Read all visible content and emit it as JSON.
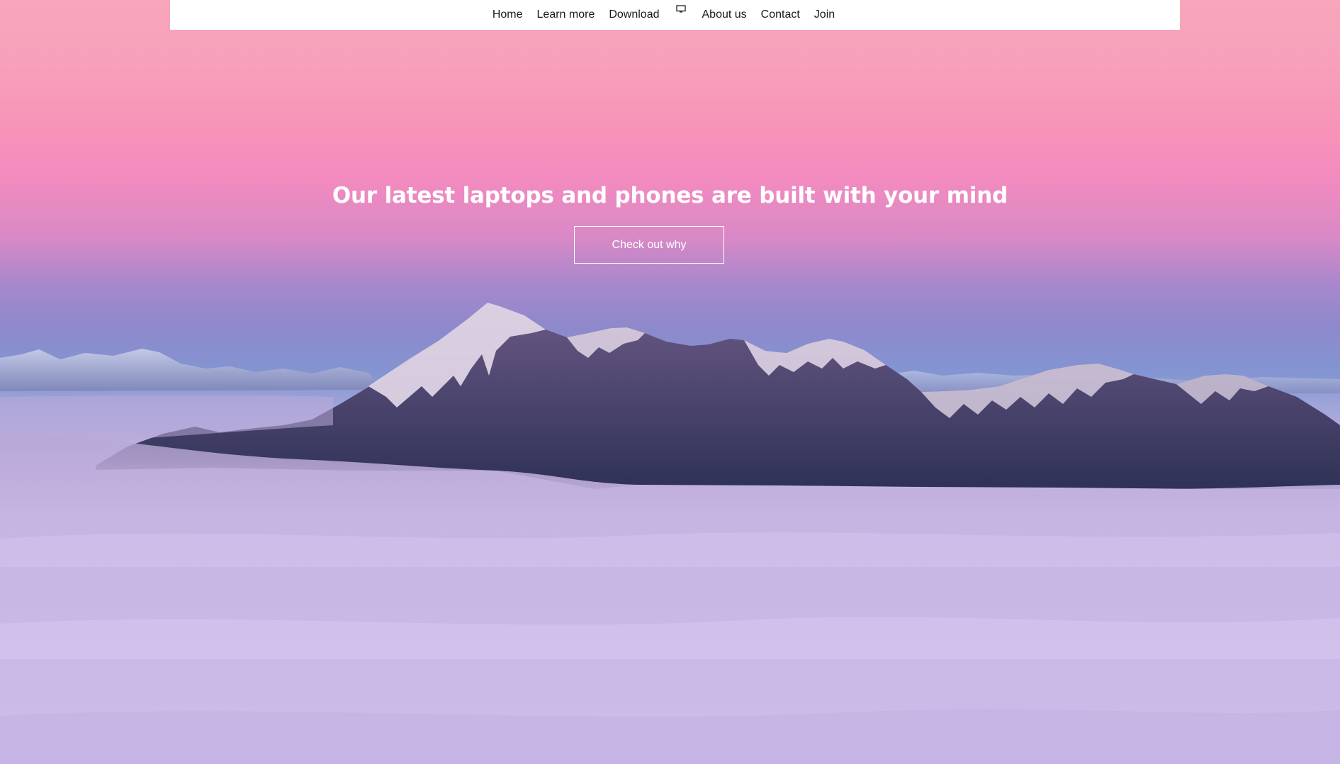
{
  "nav": {
    "items": [
      {
        "label": "Home"
      },
      {
        "label": "Learn more"
      },
      {
        "label": "Download"
      },
      {
        "icon": "monitor-icon"
      },
      {
        "label": "About us"
      },
      {
        "label": "Contact"
      },
      {
        "label": "Join"
      }
    ]
  },
  "hero": {
    "title": "Our latest laptops and phones are built with your mind",
    "button_label": "Check out why"
  },
  "colors": {
    "nav_background": "#ffffff",
    "sky_top": "#f8a6bb",
    "sky_pink": "#f48bbf",
    "sky_violet": "#8d89cc",
    "clouds": "#c9b8e6",
    "mountain_shadow": "#3a3a66",
    "hero_text": "#ffffff"
  }
}
